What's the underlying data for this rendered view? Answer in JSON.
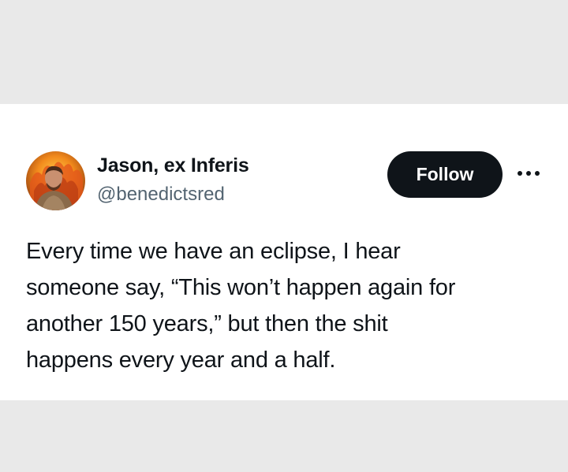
{
  "tweet": {
    "author": {
      "display_name": "Jason, ex Inferis",
      "handle": "@benedictsred",
      "avatar_icon": "profile-photo-with-flames"
    },
    "follow_label": "Follow",
    "more_icon": "more-horizontal-icon",
    "text_lines": [
      "Every time we have an eclipse, I hear",
      "someone say, “This won’t happen again for",
      "another 150 years,” but then the shit",
      "happens every year and a half."
    ]
  },
  "colors": {
    "background": "#e9e9e9",
    "card": "#ffffff",
    "text_primary": "#0f1419",
    "text_secondary": "#536471",
    "button_bg": "#0f1419",
    "button_text": "#ffffff"
  }
}
